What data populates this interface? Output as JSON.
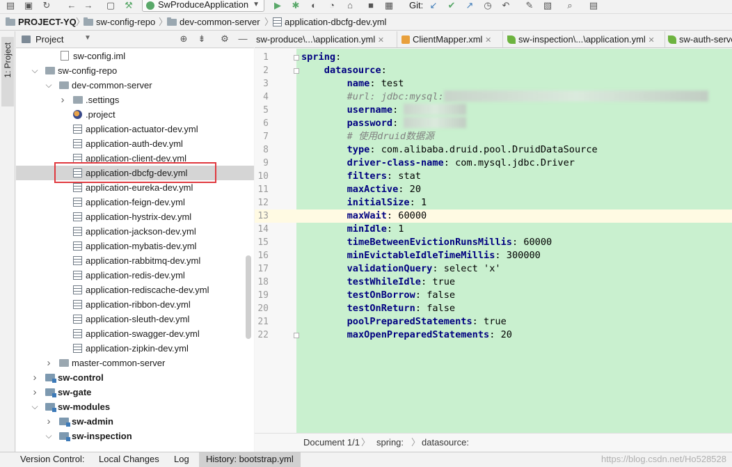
{
  "toolbar": {
    "run_config": "SwProduceApplication",
    "git_label": "Git:"
  },
  "breadcrumb": {
    "project": "PROJECT-YQ",
    "items": [
      "sw-config-repo",
      "dev-common-server",
      "application-dbcfg-dev.yml"
    ]
  },
  "stripe": {
    "project_tab": "1: Project"
  },
  "project_panel": {
    "title": "Project"
  },
  "tree": [
    {
      "label": "sw-config.iml"
    },
    {
      "label": "sw-config-repo"
    },
    {
      "label": "dev-common-server"
    },
    {
      "label": ".settings"
    },
    {
      "label": ".project"
    },
    {
      "label": "application-actuator-dev.yml"
    },
    {
      "label": "application-auth-dev.yml"
    },
    {
      "label": "application-client-dev.yml"
    },
    {
      "label": "application-dbcfg-dev.yml"
    },
    {
      "label": "application-eureka-dev.yml"
    },
    {
      "label": "application-feign-dev.yml"
    },
    {
      "label": "application-hystrix-dev.yml"
    },
    {
      "label": "application-jackson-dev.yml"
    },
    {
      "label": "application-mybatis-dev.yml"
    },
    {
      "label": "application-rabbitmq-dev.yml"
    },
    {
      "label": "application-redis-dev.yml"
    },
    {
      "label": "application-rediscache-dev.yml"
    },
    {
      "label": "application-ribbon-dev.yml"
    },
    {
      "label": "application-sleuth-dev.yml"
    },
    {
      "label": "application-swagger-dev.yml"
    },
    {
      "label": "application-zipkin-dev.yml"
    },
    {
      "label": "master-common-server"
    },
    {
      "label": "sw-control"
    },
    {
      "label": "sw-gate"
    },
    {
      "label": "sw-modules"
    },
    {
      "label": "sw-admin"
    },
    {
      "label": "sw-inspection"
    }
  ],
  "tabs": [
    {
      "label": "sw-produce\\...\\application.yml"
    },
    {
      "label": "ClientMapper.xml"
    },
    {
      "label": "sw-inspection\\...\\application.yml"
    },
    {
      "label": "sw-auth-server"
    }
  ],
  "editor": {
    "current_line": 13,
    "lines": [
      {
        "n": "1",
        "key": "spring",
        "sep": ":",
        "val": ""
      },
      {
        "n": "2",
        "key": "datasource",
        "sep": ":",
        "val": ""
      },
      {
        "n": "3",
        "key": "name",
        "sep": ": ",
        "val": "test"
      },
      {
        "n": "4",
        "comment": "#url: jdbc:mysql:"
      },
      {
        "n": "5",
        "key": "username",
        "sep": ": ",
        "val": ""
      },
      {
        "n": "6",
        "key": "password",
        "sep": ": ",
        "val": ""
      },
      {
        "n": "7",
        "comment": "# 使用druid数据源"
      },
      {
        "n": "8",
        "key": "type",
        "sep": ": ",
        "val": "com.alibaba.druid.pool.DruidDataSource"
      },
      {
        "n": "9",
        "key": "driver-class-name",
        "sep": ": ",
        "val": "com.mysql.jdbc.Driver"
      },
      {
        "n": "10",
        "key": "filters",
        "sep": ": ",
        "val": "stat"
      },
      {
        "n": "11",
        "key": "maxActive",
        "sep": ": ",
        "val": "20"
      },
      {
        "n": "12",
        "key": "initialSize",
        "sep": ": ",
        "val": "1"
      },
      {
        "n": "13",
        "key": "maxWait",
        "sep": ": ",
        "val": "60000"
      },
      {
        "n": "14",
        "key": "minIdle",
        "sep": ": ",
        "val": "1"
      },
      {
        "n": "15",
        "key": "timeBetweenEvictionRunsMillis",
        "sep": ": ",
        "val": "60000"
      },
      {
        "n": "16",
        "key": "minEvictableIdleTimeMillis",
        "sep": ": ",
        "val": "300000"
      },
      {
        "n": "17",
        "key": "validationQuery",
        "sep": ": ",
        "val": "select 'x'"
      },
      {
        "n": "18",
        "key": "testWhileIdle",
        "sep": ": ",
        "val": "true"
      },
      {
        "n": "19",
        "key": "testOnBorrow",
        "sep": ": ",
        "val": "false"
      },
      {
        "n": "20",
        "key": "testOnReturn",
        "sep": ": ",
        "val": "false"
      },
      {
        "n": "21",
        "key": "poolPreparedStatements",
        "sep": ": ",
        "val": "true"
      },
      {
        "n": "22",
        "key": "maxOpenPreparedStatements",
        "sep": ": ",
        "val": "20"
      }
    ],
    "crumbs": {
      "doc": "Document 1/1",
      "a": "spring:",
      "b": "datasource:"
    }
  },
  "bottom": {
    "tabs": [
      "Version Control:",
      "Local Changes",
      "Log",
      "History: bootstrap.yml"
    ],
    "watermark": "https://blog.csdn.net/Ho528528"
  },
  "colors": {
    "editor_bg": "#c9f0cf",
    "selection_box": "#e0383e",
    "keyword": "#000080"
  }
}
